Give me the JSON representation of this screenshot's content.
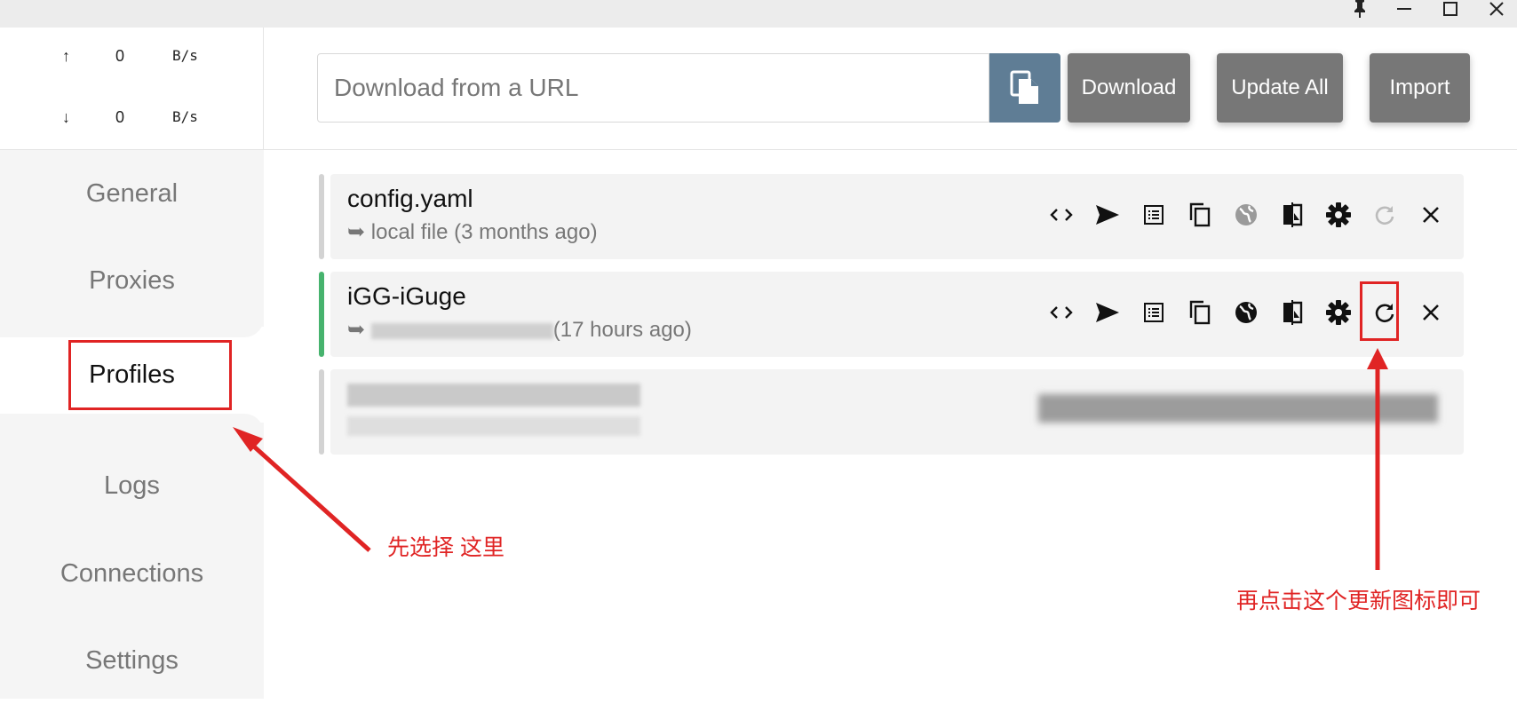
{
  "window": {
    "pin_icon": "pin-icon",
    "minimize_icon": "minimize-icon",
    "maximize_icon": "maximize-icon",
    "close_icon": "close-icon"
  },
  "traffic": {
    "up": {
      "arrow": "↑",
      "value": "0",
      "unit": "B/s"
    },
    "down": {
      "arrow": "↓",
      "value": "0",
      "unit": "B/s"
    }
  },
  "sidebar": {
    "items": [
      {
        "label": "General"
      },
      {
        "label": "Proxies"
      },
      {
        "label": "Profiles"
      },
      {
        "label": "Logs"
      },
      {
        "label": "Connections"
      },
      {
        "label": "Settings"
      }
    ],
    "active": "Profiles"
  },
  "toolbar": {
    "url_placeholder": "Download from a URL",
    "paste_icon": "paste-icon",
    "download_label": "Download",
    "update_all_label": "Update All",
    "import_label": "Import"
  },
  "profiles": [
    {
      "name": "config.yaml",
      "source_prefix": "➥",
      "source": "local file (3 months ago)",
      "selected": false
    },
    {
      "name": "iGG-iGuge",
      "source_prefix": "➥",
      "source": "(17 hours ago)",
      "selected": true
    },
    {
      "name": "",
      "source": "",
      "selected": false,
      "blurred": true
    }
  ],
  "profile_actions": [
    "code-icon",
    "send-icon",
    "list-icon",
    "copy-icon",
    "globe-icon",
    "compare-icon",
    "settings-gear-icon",
    "refresh-icon",
    "delete-icon"
  ],
  "annotations": {
    "select_here": "先选择 这里",
    "click_refresh": "再点击这个更新图标即可"
  },
  "colors": {
    "accent_selected": "#47b36e",
    "paste_button": "#5f7d95",
    "action_button": "#777777",
    "annotation_red": "#e02424"
  }
}
